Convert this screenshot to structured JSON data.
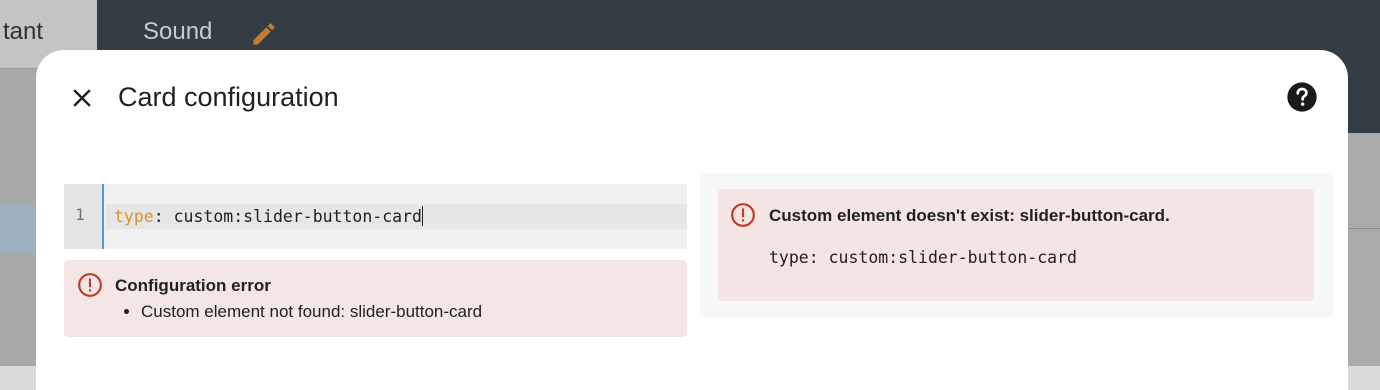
{
  "background": {
    "left_tab_label": "tant",
    "view_title": "Sound",
    "edit_icon": "pencil-icon",
    "colors": {
      "header": "#343d44",
      "edit_icon": "#c77c2a"
    }
  },
  "dialog": {
    "title": "Card configuration",
    "close_icon": "close-icon",
    "help_icon": "help-circle-icon"
  },
  "editor": {
    "line_number": "1",
    "code_key": "type",
    "code_rest": ": custom:slider-button-card",
    "colors": {
      "key": "#e0912f",
      "gutter_border": "#4e9bd8"
    }
  },
  "config_error": {
    "icon": "alert-circle-icon",
    "title": "Configuration error",
    "items": [
      "Custom element not found: slider-button-card"
    ],
    "colors": {
      "background": "#f4e6e5",
      "icon": "#c0392b"
    }
  },
  "preview": {
    "icon": "alert-circle-icon",
    "error_title": "Custom element doesn't exist: slider-button-card.",
    "error_code": "type: custom:slider-button-card"
  }
}
